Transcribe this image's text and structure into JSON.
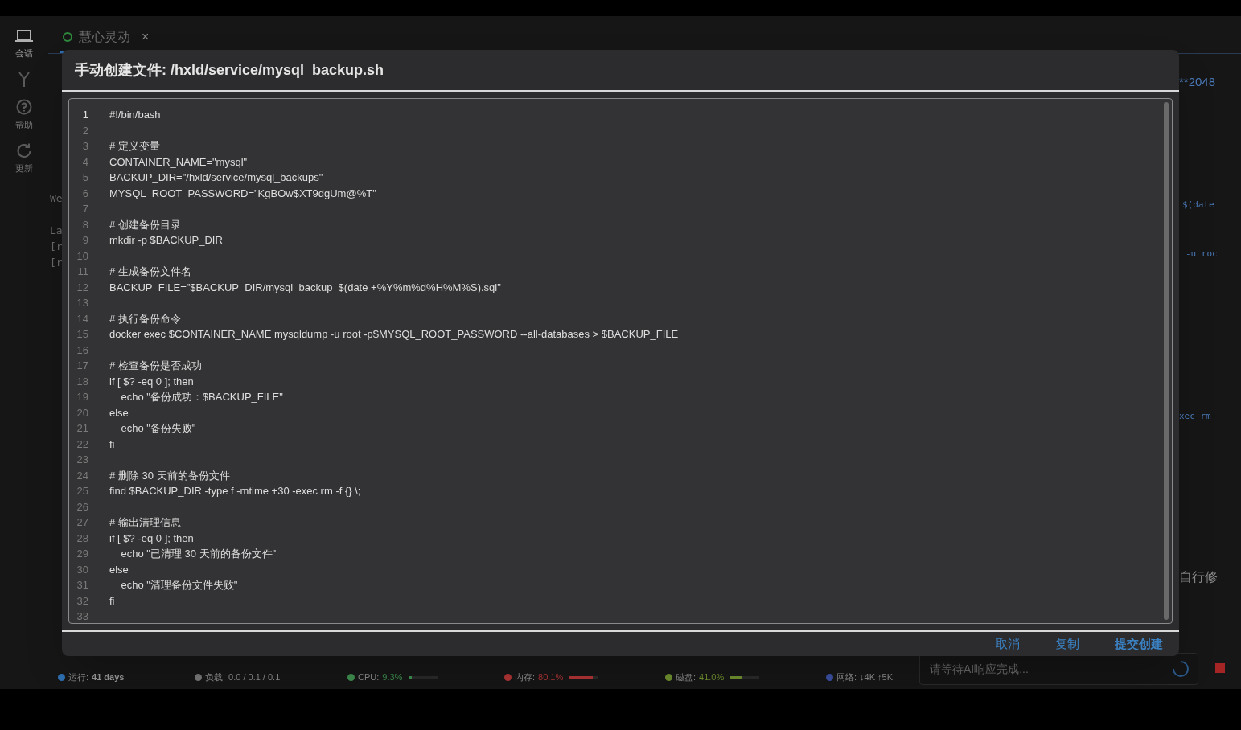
{
  "sidebar": {
    "items": [
      {
        "kind": "laptop",
        "label": "会话",
        "selected": true
      },
      {
        "kind": "fork",
        "selected": false
      },
      {
        "kind": "help",
        "label": "帮助",
        "selected": false
      },
      {
        "kind": "refresh",
        "label": "更新",
        "selected": false
      }
    ]
  },
  "tabs": [
    {
      "label": "慧心灵动",
      "selected": true,
      "connected": true,
      "close": "×"
    }
  ],
  "terminal_fragments": {
    "left": [
      "We",
      "La",
      "[r",
      "[r"
    ],
    "right": [
      "**2048",
      "$(date",
      "-u roc",
      "xec rm",
      "自行修"
    ]
  },
  "dialog": {
    "title": "手动创建文件: /hxld/service/mysql_backup.sh",
    "lines": [
      {
        "number": "1",
        "code": "#!/bin/bash",
        "selected": true
      },
      {
        "number": "2",
        "selected": false
      },
      {
        "number": "3",
        "code": "# 定义变量",
        "selected": false
      },
      {
        "number": "4",
        "code": "CONTAINER_NAME=\"mysql\"",
        "selected": false
      },
      {
        "number": "5",
        "code": "BACKUP_DIR=\"/hxld/service/mysql_backups\"",
        "selected": false
      },
      {
        "number": "6",
        "code": "MYSQL_ROOT_PASSWORD=\"KgBOw$XT9dgUm@%T\"",
        "selected": false
      },
      {
        "number": "7",
        "selected": false
      },
      {
        "number": "8",
        "code": "# 创建备份目录",
        "selected": false
      },
      {
        "number": "9",
        "code": "mkdir -p $BACKUP_DIR",
        "selected": false
      },
      {
        "number": "10",
        "selected": false
      },
      {
        "number": "11",
        "code": "# 生成备份文件名",
        "selected": false
      },
      {
        "number": "12",
        "code": "BACKUP_FILE=\"$BACKUP_DIR/mysql_backup_$(date +%Y%m%d%H%M%S).sql\"",
        "selected": false
      },
      {
        "number": "13",
        "selected": false
      },
      {
        "number": "14",
        "code": "# 执行备份命令",
        "selected": false
      },
      {
        "number": "15",
        "code": "docker exec $CONTAINER_NAME mysqldump -u root -p$MYSQL_ROOT_PASSWORD --all-databases > $BACKUP_FILE",
        "selected": false
      },
      {
        "number": "16",
        "selected": false
      },
      {
        "number": "17",
        "code": "# 检查备份是否成功",
        "selected": false
      },
      {
        "number": "18",
        "code": "if [ $? -eq 0 ]; then",
        "selected": false
      },
      {
        "number": "19",
        "code": "    echo \"备份成功：$BACKUP_FILE\"",
        "selected": false
      },
      {
        "number": "20",
        "code": "else",
        "selected": false
      },
      {
        "number": "21",
        "code": "    echo \"备份失败\"",
        "selected": false
      },
      {
        "number": "22",
        "code": "fi",
        "selected": false
      },
      {
        "number": "23",
        "selected": false
      },
      {
        "number": "24",
        "code": "# 删除 30 天前的备份文件",
        "selected": false
      },
      {
        "number": "25",
        "code": "find $BACKUP_DIR -type f -mtime +30 -exec rm -f {} \\;",
        "selected": false
      },
      {
        "number": "26",
        "selected": false
      },
      {
        "number": "27",
        "code": "# 输出清理信息",
        "selected": false
      },
      {
        "number": "28",
        "code": "if [ $? -eq 0 ]; then",
        "selected": false
      },
      {
        "number": "29",
        "code": "    echo \"已清理 30 天前的备份文件\"",
        "selected": false
      },
      {
        "number": "30",
        "code": "else",
        "selected": false
      },
      {
        "number": "31",
        "code": "    echo \"清理备份文件失败\"",
        "selected": false
      },
      {
        "number": "32",
        "code": "fi",
        "selected": false
      },
      {
        "number": "33",
        "selected": false
      }
    ],
    "buttons": [
      {
        "label": "取消",
        "primary": false
      },
      {
        "label": "复制",
        "primary": false
      },
      {
        "label": "提交创建",
        "primary": true
      }
    ]
  },
  "status_bar": [
    {
      "kind": "uptime",
      "label": "运行:",
      "value": "41 days",
      "color": "#2f6fb0"
    },
    {
      "kind": "load",
      "label": "负载:",
      "value": "0.0 / 0.1 / 0.1",
      "color": "#777777"
    },
    {
      "kind": "cpu",
      "label": "CPU:",
      "value": "9.3%",
      "color": "#3f8f4f",
      "level": 0.093
    },
    {
      "kind": "memory",
      "label": "内存:",
      "value": "80.1%",
      "color": "#b03434",
      "level": 0.801
    },
    {
      "kind": "disk",
      "label": "磁盘:",
      "value": "41.0%",
      "color": "#6f8f2f",
      "level": 0.41
    },
    {
      "kind": "network",
      "label": "网络:",
      "value": "↓4K ↑5K",
      "color": "#3a4fa0"
    }
  ],
  "chat_input": {
    "placeholder": "请等待AI响应完成..."
  }
}
